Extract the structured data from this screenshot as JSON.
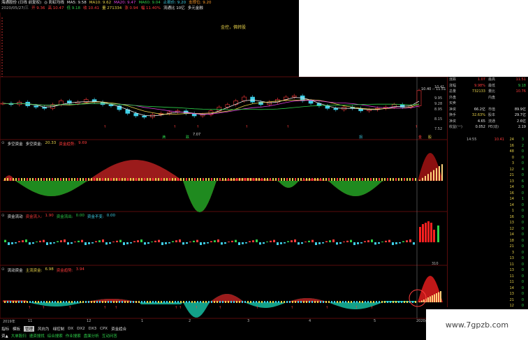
{
  "topbar": {
    "row1": [
      {
        "text": "海通股份 (日线 前复权)",
        "cls": "w"
      },
      {
        "text": "◎ 彩虹均线",
        "cls": "w"
      },
      {
        "text": "MA5: 9.58",
        "cls": "w"
      },
      {
        "text": "MA10: 9.62",
        "cls": "y"
      },
      {
        "text": "MA20: 9.47",
        "cls": "m"
      },
      {
        "text": "MA60: 9.04",
        "cls": "g"
      },
      {
        "text": "止损价: 9.20",
        "cls": "c"
      },
      {
        "text": "支撑位: 9.20",
        "cls": "o"
      }
    ],
    "row2": [
      {
        "text": "2020/05/27/三",
        "cls": "gr"
      },
      {
        "text": "开 9.36",
        "cls": "r"
      },
      {
        "text": "高 10.47",
        "cls": "r"
      },
      {
        "text": "低 9.18",
        "cls": "g"
      },
      {
        "text": "收 10.41",
        "cls": "r"
      },
      {
        "text": "量 271334",
        "cls": "y"
      },
      {
        "text": "涨 0.94",
        "cls": "r"
      },
      {
        "text": "幅 11.40%",
        "cls": "r"
      },
      {
        "text": "流通比 10亿",
        "cls": "w"
      },
      {
        "text": "多元金融",
        "cls": "w"
      }
    ]
  },
  "note": "金控，佛转股",
  "main_price_labels": [
    "10.41",
    "9.95",
    "9.28",
    "8.95",
    "8.15",
    "7.52"
  ],
  "price_tip": "10.40 -- 11.51",
  "low_label": "7.07",
  "bottom_marks": [
    {
      "t": "满",
      "cls": "g"
    },
    {
      "t": "跌",
      "cls": "g"
    },
    {
      "t": "拐",
      "cls": "c"
    },
    {
      "t": "金",
      "cls": "r"
    },
    {
      "t": "股",
      "cls": "y"
    }
  ],
  "panel1": {
    "title": "多空资金",
    "items": [
      {
        "t": "多空资金:",
        "cls": "w"
      },
      {
        "t": "20.33",
        "cls": "y"
      },
      {
        "t": "资金趋势:",
        "cls": "r"
      },
      {
        "t": "9.69",
        "cls": "r"
      }
    ],
    "yticks": [
      "150.0",
      "50.00",
      "-50.00",
      "-100.0"
    ]
  },
  "panel2": {
    "title": "资金流动",
    "items": [
      {
        "t": "资金流入:",
        "cls": "r"
      },
      {
        "t": "1.90",
        "cls": "r"
      },
      {
        "t": "资金流出:",
        "cls": "g"
      },
      {
        "t": "0.00",
        "cls": "g"
      },
      {
        "t": "资金不变:",
        "cls": "c"
      },
      {
        "t": "0.00",
        "cls": "c"
      }
    ],
    "yticks": [
      "10000",
      "5000",
      "-5000"
    ]
  },
  "panel3": {
    "title": "流动资金",
    "items": [
      {
        "t": "主流资金:",
        "cls": "y"
      },
      {
        "t": "6.98",
        "cls": "y"
      },
      {
        "t": "资金趋势:",
        "cls": "r"
      },
      {
        "t": "3.94",
        "cls": "r"
      }
    ],
    "yticks": [
      "15.00",
      "10.00",
      "5.00",
      "0.00"
    ]
  },
  "extra_labels": {
    "vol_label": "310",
    "t1455": "14:55",
    "t1456": "14:56",
    "t1454": "14:54"
  },
  "quote_rows": [
    {
      "k": "涨跌",
      "v": "1.07",
      "vc": "r",
      "k2": "最高",
      "v2": "11.51",
      "v2c": "r"
    },
    {
      "k": "涨幅",
      "v": "9.98%",
      "vc": "r",
      "k2": "最低",
      "v2": "9.18",
      "v2c": "g"
    },
    {
      "k": "总量",
      "v": "732133",
      "vc": "y",
      "k2": "量比",
      "v2": "10.76",
      "v2c": "r"
    },
    {
      "k": "外盘",
      "v": "",
      "vc": "w",
      "k2": "内盘",
      "v2": "",
      "v2c": "g"
    },
    {
      "k": "买卖",
      "v": "",
      "vc": "w",
      "k2": "",
      "v2": "",
      "v2c": "w"
    },
    {
      "k": "净资",
      "v": "66.2亿",
      "vc": "w",
      "k2": "市值",
      "v2": "89.9亿",
      "v2c": "w"
    },
    {
      "k": "换手",
      "v": "32.63%",
      "vc": "y",
      "k2": "股本",
      "v2": "29.7亿",
      "v2c": "w"
    },
    {
      "k": "净资",
      "v": "4.65",
      "vc": "w",
      "k2": "流通",
      "v2": "2.6亿",
      "v2c": "w"
    },
    {
      "k": "收益(一)",
      "v": "0.052",
      "vc": "w",
      "k2": "PE(动)",
      "v2": "2.19",
      "v2c": "w"
    }
  ],
  "ticks": [
    [
      "14:55",
      "10.41",
      "24",
      "3"
    ],
    [
      "",
      "",
      "16",
      "2"
    ],
    [
      "",
      "",
      "48",
      "0"
    ],
    [
      "",
      "",
      "0",
      "0"
    ],
    [
      "",
      "",
      "3",
      "0"
    ],
    [
      "",
      "",
      "12",
      "4"
    ],
    [
      "",
      "",
      "21",
      "0"
    ],
    [
      "",
      "",
      "13",
      "6"
    ],
    [
      "",
      "",
      "14",
      "0"
    ],
    [
      "",
      "",
      "16",
      "0"
    ],
    [
      "",
      "",
      "14",
      "1"
    ],
    [
      "",
      "",
      "14",
      "0"
    ],
    [
      "",
      "",
      "1",
      "0"
    ],
    [
      "",
      "",
      "16",
      "0"
    ],
    [
      "",
      "",
      "13",
      "0"
    ],
    [
      "",
      "",
      "12",
      "0"
    ],
    [
      "",
      "",
      "14",
      "0"
    ],
    [
      "",
      "",
      "18",
      "0"
    ],
    [
      "",
      "",
      "21",
      "0"
    ],
    [
      "",
      "",
      "3",
      "0"
    ],
    [
      "",
      "",
      "13",
      "0"
    ],
    [
      "",
      "",
      "11",
      "0"
    ],
    [
      "",
      "",
      "13",
      "0"
    ],
    [
      "",
      "",
      "11",
      "0"
    ],
    [
      "",
      "",
      "11",
      "0"
    ],
    [
      "",
      "",
      "14",
      "0"
    ],
    [
      "",
      "",
      "13",
      "0"
    ],
    [
      "",
      "",
      "21",
      "0"
    ],
    [
      "",
      "",
      "12",
      "0"
    ],
    [
      "",
      "",
      "6",
      "0"
    ]
  ],
  "xaxis": [
    {
      "t": "2019年",
      "x": 4
    },
    {
      "t": "11",
      "x": 40
    },
    {
      "t": "12",
      "x": 124
    },
    {
      "t": "1",
      "x": 202
    },
    {
      "t": "2",
      "x": 270
    },
    {
      "t": "3",
      "x": 354
    },
    {
      "t": "4",
      "x": 442
    },
    {
      "t": "5",
      "x": 535
    },
    {
      "t": "2020/5",
      "x": 596
    }
  ],
  "bottom_tabs1": [
    "指标",
    "模板",
    "管理",
    "风向为",
    "绿控制",
    "DX",
    "DX2",
    "DX3",
    "CPX",
    "资金趋合"
  ],
  "bottom_tabs2": [
    "资▲",
    "大单股扫",
    "速资搜找",
    "综合搜索",
    "作业搜索",
    "盘面分析",
    "互动问答"
  ],
  "watermark": "www.7gpzb.com",
  "chart_data": {
    "type": "line",
    "series": [
      {
        "values": [
          9.4,
          9.3,
          9.5,
          9.2,
          9.1,
          9.0,
          9.3,
          9.6,
          9.4,
          9.5,
          9.7,
          9.5,
          9.3,
          9.2,
          8.9,
          8.6,
          8.4,
          8.3,
          8.5,
          8.6,
          8.7,
          8.8,
          8.6,
          8.4,
          8.5,
          8.8,
          9.1,
          9.3,
          9.6,
          9.9,
          9.5,
          9.3,
          9.5,
          9.7,
          9.9,
          10.0,
          9.6,
          9.4,
          9.2,
          9.0,
          8.9,
          9.1,
          9.0,
          8.8,
          8.9,
          9.0,
          9.1,
          9.3,
          9.1,
          9.2,
          10.41
        ]
      }
    ],
    "ylim": [
      7.07,
      11.51
    ]
  }
}
